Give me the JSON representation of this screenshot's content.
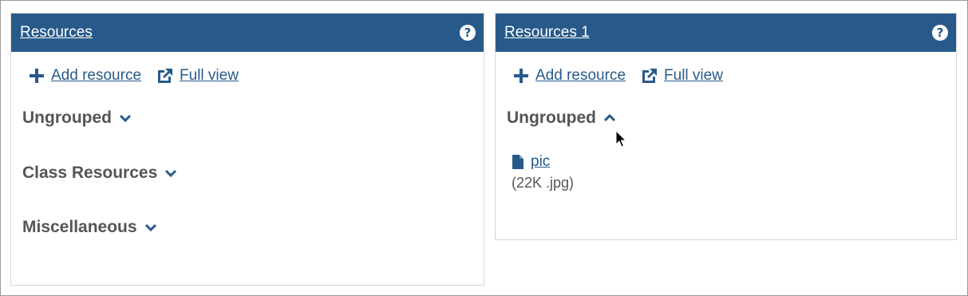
{
  "panels": [
    {
      "title": "Resources",
      "add_label": "Add resource",
      "fullview_label": "Full view",
      "groups": [
        "Ungrouped",
        "Class Resources",
        "Miscellaneous"
      ]
    },
    {
      "title": "Resources 1",
      "add_label": "Add resource",
      "fullview_label": "Full view",
      "group": "Ungrouped",
      "file": {
        "name": "pic",
        "meta": "(22K .jpg)"
      }
    }
  ],
  "icons": {
    "help": "?",
    "add": "plus-icon",
    "fullview": "external-arrow-icon",
    "collapsed": "chevron-down-icon",
    "expanded": "chevron-up-icon",
    "file": "file-icon"
  },
  "colors": {
    "header_bg": "#275a8a",
    "link": "#275a8a",
    "text": "#555555"
  }
}
